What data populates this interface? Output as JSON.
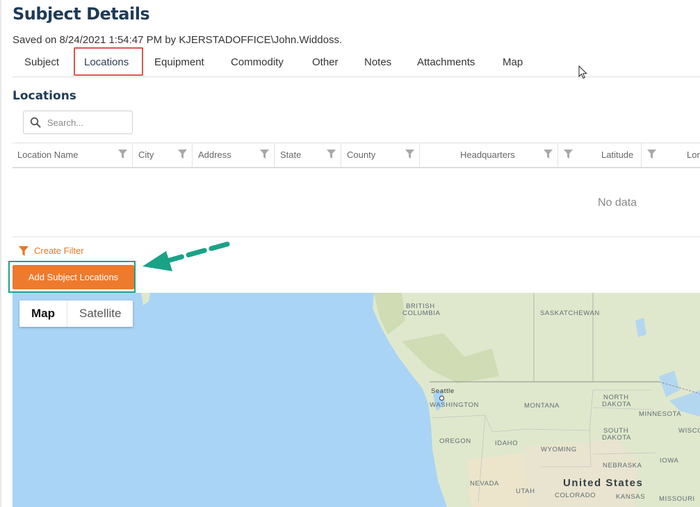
{
  "page": {
    "title": "Subject Details",
    "saved_line": "Saved on 8/24/2021 1:54:47 PM by KJERSTADOFFICE\\John.Widdoss."
  },
  "tabs": [
    {
      "label": "Subject"
    },
    {
      "label": "Locations",
      "active": true
    },
    {
      "label": "Equipment"
    },
    {
      "label": "Commodity"
    },
    {
      "label": "Other"
    },
    {
      "label": "Notes"
    },
    {
      "label": "Attachments"
    },
    {
      "label": "Map"
    }
  ],
  "locations": {
    "section_title": "Locations",
    "search_placeholder": "Search...",
    "columns": [
      "Location Name",
      "City",
      "Address",
      "State",
      "County",
      "Headquarters",
      "Latitude",
      "Lon"
    ],
    "empty_text": "No data",
    "create_filter_label": "Create Filter",
    "add_button_label": "Add Subject Locations"
  },
  "map": {
    "type_buttons": [
      "Map",
      "Satellite"
    ],
    "selected_type": "Map",
    "labels": {
      "british_columbia": [
        "BRITISH",
        "COLUMBIA"
      ],
      "saskatchewan": "SASKATCHEWAN",
      "seattle": "Seattle",
      "washington": "WASHINGTON",
      "montana": "MONTANA",
      "north_dakota": [
        "NORTH",
        "DAKOTA"
      ],
      "minnesota": "MINNESOTA",
      "south_dakota": [
        "SOUTH",
        "DAKOTA"
      ],
      "wisconsin": "WISCO",
      "oregon": "OREGON",
      "idaho": "IDAHO",
      "wyoming": "WYOMING",
      "iowa": "IOWA",
      "nebraska": "NEBRASKA",
      "nevada": "NEVADA",
      "utah": "UTAH",
      "colorado": "COLORADO",
      "kansas": "KANSAS",
      "missouri": "MISSOURI",
      "united_states": "United States"
    }
  },
  "colors": {
    "title": "#1f3a57",
    "accent_orange": "#ee7a2d",
    "filter_orange": "#e87722",
    "highlight_red": "#e0534f",
    "highlight_green": "#1aa287",
    "map_water": "#a9d4f5",
    "map_land": "#dfe8cc"
  }
}
